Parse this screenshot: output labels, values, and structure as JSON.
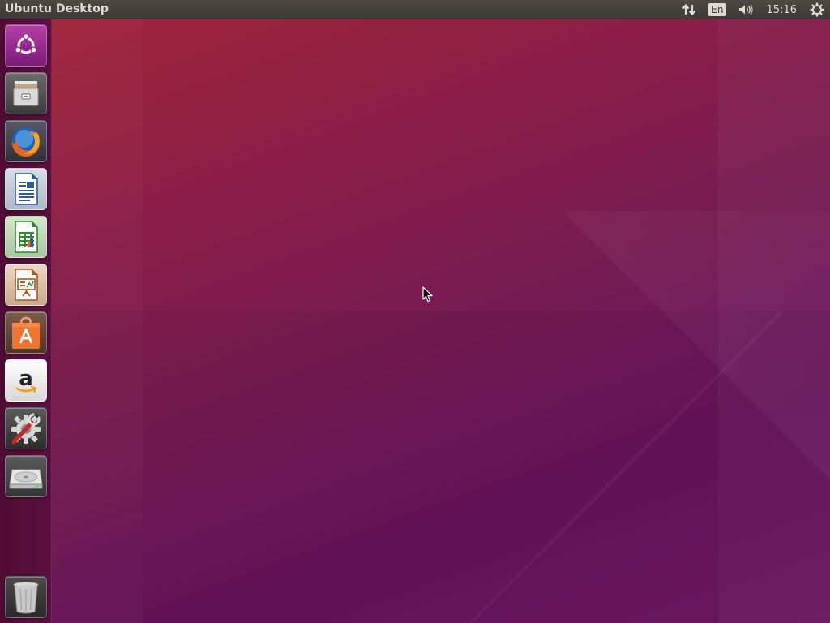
{
  "top_panel": {
    "title": "Ubuntu Desktop",
    "keyboard_layout": "En",
    "clock": "15:16",
    "icons": [
      "network-transfer-icon",
      "keyboard-layout-indicator",
      "volume-icon",
      "system-gear-icon"
    ]
  },
  "launcher": {
    "items": [
      {
        "name": "dash-home",
        "icon": "ubuntu-logo-icon"
      },
      {
        "name": "files",
        "icon": "file-cabinet-icon"
      },
      {
        "name": "firefox",
        "icon": "firefox-icon"
      },
      {
        "name": "libreoffice-writer",
        "icon": "writer-document-icon"
      },
      {
        "name": "libreoffice-calc",
        "icon": "calc-spreadsheet-icon"
      },
      {
        "name": "libreoffice-impress",
        "icon": "impress-presentation-icon"
      },
      {
        "name": "ubuntu-software",
        "icon": "software-bag-icon"
      },
      {
        "name": "amazon",
        "icon": "amazon-icon"
      },
      {
        "name": "system-settings",
        "icon": "settings-wrench-gear-icon"
      },
      {
        "name": "disk-drive",
        "icon": "hard-drive-icon"
      },
      {
        "name": "trash",
        "icon": "trash-icon"
      }
    ]
  },
  "colors": {
    "panel": "#3c3b37",
    "launcher": "#4e0c35",
    "wallpaper_top": "#a5243a",
    "wallpaper_bottom": "#66135a",
    "panel_text": "#dfdbd2"
  }
}
